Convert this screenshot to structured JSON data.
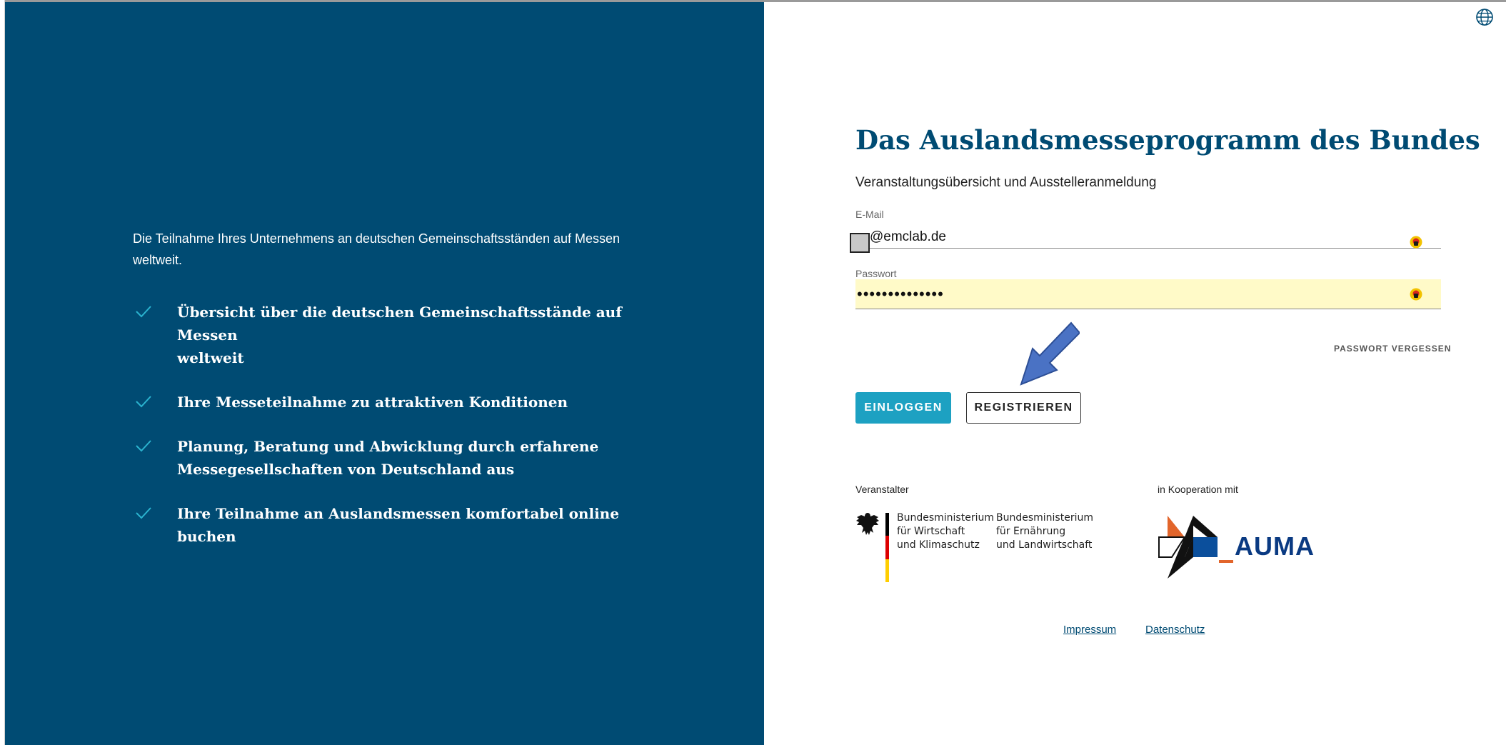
{
  "left": {
    "intro": "Die Teilnahme Ihres Unternehmens an deutschen Gemeinschaftsständen auf Messen weltweit.",
    "features": [
      {
        "line1": "Übersicht über die deutschen Gemeinschaftsstände auf Messen",
        "line2": "weltweit"
      },
      {
        "line1": "Ihre Messeteilnahme zu attraktiven Konditionen",
        "line2": ""
      },
      {
        "line1": "Planung, Beratung und Abwicklung durch erfahrene",
        "line2": "Messegesellschaften von Deutschland aus"
      },
      {
        "line1": "Ihre Teilnahme an Auslandsmessen komfortabel online buchen",
        "line2": ""
      }
    ]
  },
  "header": {
    "globe_icon": "globe-icon"
  },
  "form": {
    "title": "Das Auslandsmesseprogramm des Bundes",
    "subtitle": "Veranstaltungsübersicht und Ausstelleranmeldung",
    "email_label": "E-Mail",
    "email_value": "@emclab.de",
    "password_label": "Passwort",
    "password_value": "••••••••••••••",
    "forgot_password": "PASSWORT VERGESSEN",
    "login_button": "EINLOGGEN",
    "register_button": "REGISTRIEREN"
  },
  "organizers": {
    "host_label": "Veranstalter",
    "coop_label": "in Kooperation mit",
    "ministry1": [
      "Bundesministerium",
      "für Wirtschaft",
      "und Klimaschutz"
    ],
    "ministry2": [
      "Bundesministerium",
      "für Ernährung",
      "und Landwirtschaft"
    ],
    "auma_text": "AUMA"
  },
  "footer": {
    "impressum": "Impressum",
    "datenschutz": "Datenschutz"
  },
  "colors": {
    "panel_bg": "#004b73",
    "accent": "#1da1c2",
    "check": "#2bb3cf",
    "title": "#004b73",
    "autofill": "#fffac8"
  }
}
